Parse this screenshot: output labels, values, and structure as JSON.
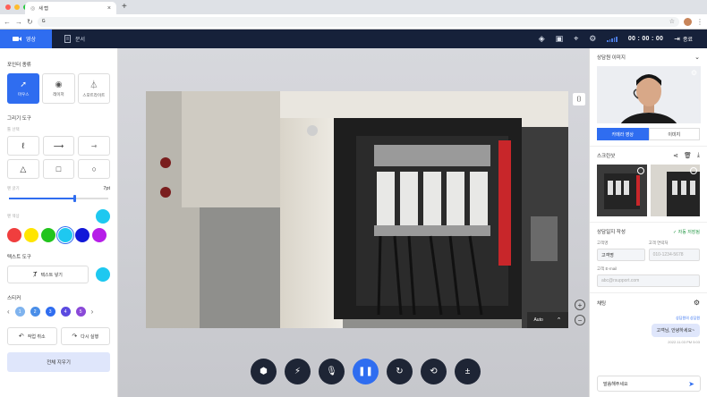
{
  "browser": {
    "tab_title": "새 탭",
    "url": "G"
  },
  "header": {
    "tab_video": "영상",
    "tab_doc": "문서",
    "timer": "00 : 00 : 00",
    "end_label": "종료"
  },
  "left": {
    "pointer_title": "포인터 종류",
    "pointers": [
      "마우스",
      "레이저",
      "스포트라이트"
    ],
    "draw_title": "그리기 도구",
    "draw_sub": "툴 선택",
    "width_label": "펜 굵기",
    "width_value": "7pt",
    "width_fraction": 0.65,
    "color_label": "펜 색상",
    "colors": [
      "#f03e3e",
      "#ffe500",
      "#22c41d",
      "#1ec8f0",
      "#1118d8",
      "#b61ee8"
    ],
    "current_color": "#1ec8f0",
    "text_title": "텍스트 도구",
    "text_button": "텍스트 넣기",
    "sticker_title": "스티커",
    "stickers": [
      "1",
      "2",
      "3",
      "4",
      "5"
    ],
    "undo": "작업 취소",
    "redo": "다시 실행",
    "clear_all": "전체 지우기"
  },
  "video": {
    "quality": "Auto"
  },
  "right": {
    "agent_image_title": "상담원 이미지",
    "cam_tab": "카메라 영상",
    "img_tab": "이미지",
    "screenshot_title": "스크린샷",
    "form_title": "상담일지 작성",
    "autosave": "✓ 자동 저장됨",
    "name_label": "고객명",
    "name_value": "고객명",
    "phone_label": "고객 연락처",
    "phone_placeholder": "010-1234-5678",
    "email_label": "고객 E-mail",
    "email_placeholder": "abc@rsupport.com",
    "chat_title": "채팅",
    "chat_sender": "상담원의 상담원",
    "chat_message": "고객님, 안녕하세요~",
    "chat_time": "2022.11.03 PM 5:03",
    "chat_input": "말씀해주세요"
  }
}
